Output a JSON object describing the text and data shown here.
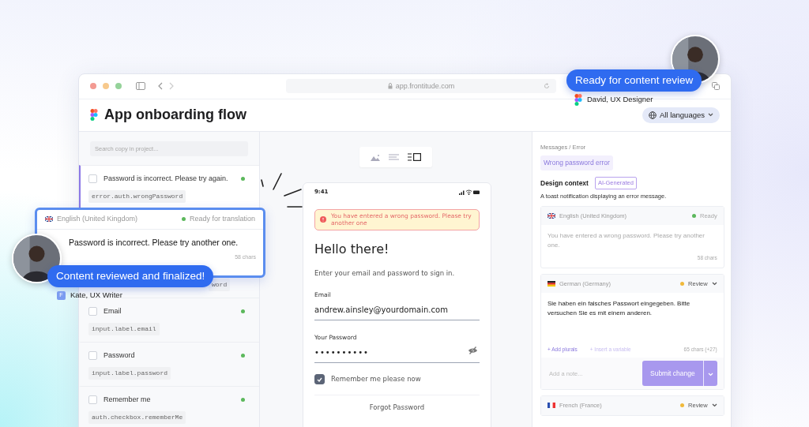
{
  "browser": {
    "url": "app.frontitude.com"
  },
  "header": {
    "title": "App onboarding flow",
    "language_filter": "All languages"
  },
  "sidebar": {
    "search_placeholder": "Search copy in project...",
    "items": [
      {
        "kind": "full",
        "text": "Password is incorrect. Please try again.",
        "key": "error.auth.wrongPassword",
        "checked": false,
        "selected": true,
        "color": "#5cb85c"
      },
      {
        "kind": "covered",
        "key": "word"
      },
      {
        "kind": "full",
        "text": "Email",
        "key": "input.label.email",
        "checked": false,
        "selected": false,
        "color": "#5cb85c"
      },
      {
        "kind": "full",
        "text": "Password",
        "key": "input.label.password",
        "checked": false,
        "selected": false,
        "color": "#5cb85c"
      },
      {
        "kind": "full",
        "text": "Remember me",
        "key": "auth.checkbox.rememberMe",
        "checked": false,
        "selected": false,
        "color": "#5cb85c"
      }
    ]
  },
  "preview": {
    "phone": {
      "time": "9:41",
      "alert": "You have entered a wrong password. Please try another one",
      "heading": "Hello there!",
      "subtitle": "Enter your email and password to sign in.",
      "email_label": "Email",
      "email_value": "andrew.ainsley@yourdomain.com",
      "password_label": "Your Password",
      "password_value": "••••••••••",
      "remember": {
        "label": "Remember me please now",
        "checked": true
      },
      "forgot": "Forgot Password"
    }
  },
  "details": {
    "breadcrumb": "Messages / Error",
    "tag": "Wrong password error",
    "context_title": "Design context",
    "ai_badge": "AI-Generated",
    "context_text": "A toast notification displaying an error message.",
    "translations": [
      {
        "kind": "source",
        "flag": {
          "kind": "uk"
        },
        "language": "English (United Kingdom)",
        "status": "Ready",
        "color": "#5cb85c",
        "text": "You have entered a wrong password. Please try another one.",
        "count": "58 chars"
      },
      {
        "kind": "editing",
        "flag": {
          "kind": "de"
        },
        "language": "German (Germany)",
        "status": "Review",
        "color": "#f0b93b",
        "text": "Sie haben ein falsches Passwort eingegeben. Bitte versuchen Sie es mit einem anderen.",
        "actions": [
          "+ Add plurals",
          "+ Insert a variable"
        ],
        "count": "65 chars (+27)",
        "note_placeholder": "Add a note...",
        "submit": {
          "label": "Submit change",
          "disabled": true
        }
      },
      {
        "kind": "collapsed",
        "flag": {
          "kind": "fr"
        },
        "language": "French (France)",
        "status": "Review",
        "color": "#f0b93b"
      }
    ]
  },
  "floating_card": {
    "flag": {
      "kind": "uk"
    },
    "language": "English (United Kingdom)",
    "status": "Ready for translation",
    "color": "#5cb85c",
    "text": "Password is incorrect. Please try another one.",
    "count": "58 chars"
  },
  "comments": [
    {
      "message": "Ready for content review",
      "author": "David, UX Designer",
      "badge": {
        "kind": "figma"
      }
    },
    {
      "message": "Content reviewed and finalized!",
      "author": "Kate, UX Writer",
      "badge": {
        "kind": "letter",
        "letter": "F"
      }
    }
  ]
}
